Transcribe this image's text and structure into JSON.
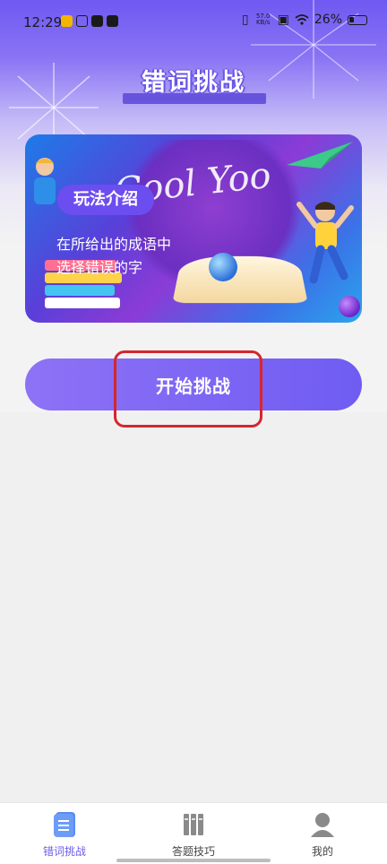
{
  "status_bar": {
    "time": "12:29",
    "net_speed_value": "57.0",
    "net_speed_unit": "KB/s",
    "battery": "26%"
  },
  "page": {
    "title": "错词挑战"
  },
  "banner": {
    "tag": "玩法介绍",
    "desc_line1": "在所给出的成语中",
    "desc_line2": "选择错误的字",
    "logo_text": "Cool Yoo"
  },
  "actions": {
    "start_label": "开始挑战"
  },
  "tabs": [
    {
      "label": "错词挑战",
      "icon": "document-list-icon",
      "active": true
    },
    {
      "label": "答题技巧",
      "icon": "books-icon",
      "active": false
    },
    {
      "label": "我的",
      "icon": "person-icon",
      "active": false
    }
  ],
  "colors": {
    "accent": "#6c5ce7",
    "button_start": "#8e72f6",
    "button_end": "#6f5cf2",
    "highlight": "#d4262e"
  }
}
